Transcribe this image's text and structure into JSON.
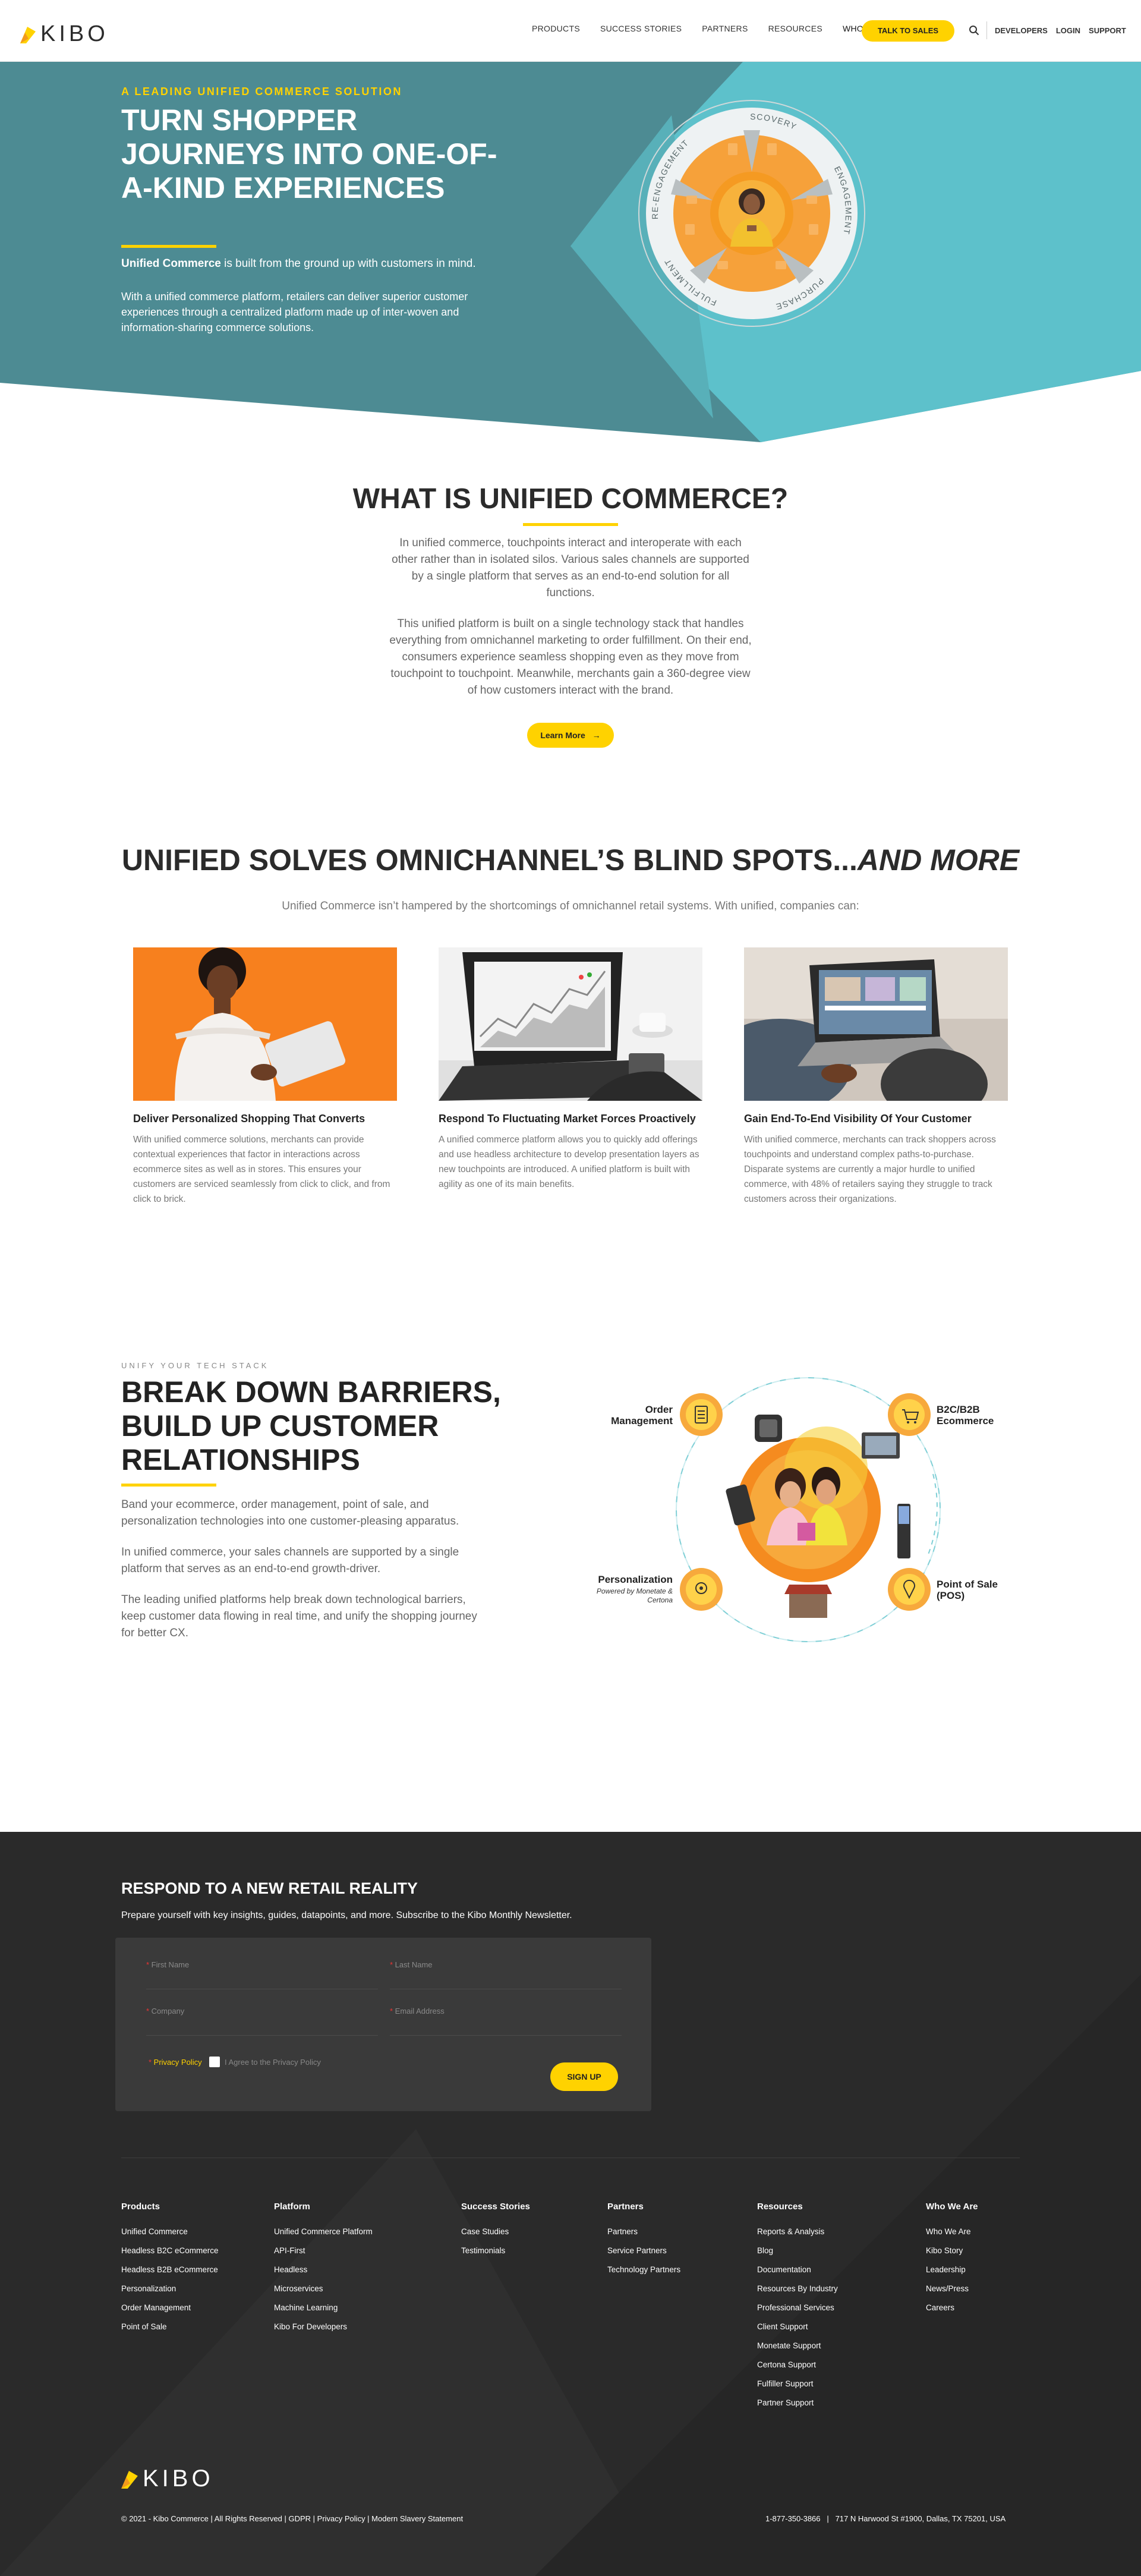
{
  "header": {
    "brand": "KIBO",
    "nav": [
      "PRODUCTS",
      "SUCCESS STORIES",
      "PARTNERS",
      "RESOURCES",
      "WHO WE ARE"
    ],
    "cta": "TALK TO SALES",
    "utility": [
      "DEVELOPERS",
      "LOGIN",
      "SUPPORT"
    ]
  },
  "hero": {
    "eyebrow": "A LEADING UNIFIED COMMERCE SOLUTION",
    "title": "TURN SHOPPER JOURNEYS INTO ONE-OF-A-KIND EXPERIENCES",
    "p1_bold": "Unified Commerce",
    "p1_rest": " is built from the ground up with customers in mind.",
    "p2": "With a unified commerce platform, retailers can deliver superior customer experiences through a centralized platform made up of inter-woven and information-sharing commerce solutions.",
    "wheel": [
      "DISCOVERY",
      "ENGAGEMENT",
      "PURCHASE",
      "FULFILLMENT",
      "RE-ENGAGEMENT"
    ]
  },
  "what": {
    "title": "WHAT IS UNIFIED COMMERCE?",
    "p1": "In unified commerce, touchpoints interact and interoperate with each other rather than in isolated silos. Various sales channels are supported by a single platform that serves as an end-to-end solution for all functions.",
    "p2": "This unified platform is built on a single technology stack that handles everything from omnichannel marketing to order fulfillment. On their end, consumers experience seamless shopping even as they move from touchpoint to touchpoint. Meanwhile, merchants gain a 360-degree view of how customers interact with the brand.",
    "button": "Learn More"
  },
  "blind": {
    "title_main": "UNIFIED SOLVES OMNICHANNEL’S BLIND SPOTS...",
    "title_italic": "AND MORE",
    "subtitle": "Unified Commerce isn’t hampered by the shortcomings of omnichannel retail systems. With unified, companies can:",
    "cards": [
      {
        "title": "Deliver Personalized Shopping That Converts",
        "text": "With unified commerce solutions, merchants can provide contextual experiences that factor in interactions across ecommerce sites as well as in stores. This ensures your customers are serviced seamlessly from click to click, and from click to brick."
      },
      {
        "title": "Respond To Fluctuating Market Forces Proactively",
        "text": "A unified commerce platform allows you to quickly add offerings and use headless architecture to develop presentation layers as new touchpoints are introduced. A unified platform is built with agility as one of its main benefits."
      },
      {
        "title": "Gain End-To-End Visibility Of Your Customer",
        "text": "With unified commerce, merchants can track shoppers across touchpoints and understand complex paths-to-purchase. Disparate systems are currently a major hurdle to unified commerce, with 48% of retailers saying they struggle to track customers across their organizations."
      }
    ]
  },
  "barriers": {
    "eyebrow": "UNIFY YOUR TECH STACK",
    "title": "BREAK DOWN BARRIERS, BUILD UP CUSTOMER RELATIONSHIPS",
    "p1": "Band your ecommerce, order management, point of sale, and personalization technologies into one customer-pleasing apparatus.",
    "p2": "In unified commerce, your sales channels are supported by a single platform that serves as an end-to-end growth-driver.",
    "p3": "The leading unified platforms help break down technological barriers, keep customer data flowing in real time, and unify the shopping journey for better CX.",
    "nodes": {
      "order": "Order Management",
      "b2c": "B2C/B2B Ecommerce",
      "pers": "Personalization",
      "pers_sub": "Powered by Monetate & Certona",
      "pos": "Point of Sale (POS)"
    }
  },
  "newsletter": {
    "title": "RESPOND TO A NEW RETAIL REALITY",
    "subtitle": "Prepare yourself with key insights, guides, datapoints, and more. Subscribe to the Kibo Monthly Newsletter.",
    "first": "First Name",
    "last": "Last Name",
    "company": "Company",
    "email": "Email Address",
    "privacy": "Privacy Policy",
    "agree": "I Agree to the Privacy Policy",
    "button": "SIGN UP"
  },
  "footer": {
    "columns": [
      {
        "title": "Products",
        "items": [
          "Unified Commerce",
          "Headless B2C eCommerce",
          "Headless B2B eCommerce",
          "Personalization",
          "Order Management",
          "Point of Sale"
        ]
      },
      {
        "title": "Platform",
        "items": [
          "Unified Commerce Platform",
          "API-First",
          "Headless",
          "Microservices",
          "Machine Learning",
          "Kibo For Developers"
        ]
      },
      {
        "title": "Success Stories",
        "items": [
          "Case Studies",
          "Testimonials"
        ]
      },
      {
        "title": "Partners",
        "items": [
          "Partners",
          "Service Partners",
          "Technology Partners"
        ]
      },
      {
        "title": "Resources",
        "items": [
          "Reports & Analysis",
          "Blog",
          "Documentation",
          "Resources By Industry",
          "Professional Services",
          "Client Support",
          "Monetate Support",
          "Certona Support",
          "Fulfiller Support",
          "Partner Support"
        ]
      },
      {
        "title": "Who We Are",
        "items": [
          "Who We Are",
          "Kibo Story",
          "Leadership",
          "News/Press",
          "Careers"
        ]
      }
    ],
    "brand": "KIBO",
    "copyright": "© 2021 - Kibo Commerce | All Rights Reserved | GDPR | Privacy Policy | Modern Slavery Statement",
    "address": "1-877-350-3866   |   717 N Harwood St #1900, Dallas, TX 75201, USA"
  },
  "colors": {
    "accent": "#ffd200",
    "teal": "#4d8c94",
    "light_teal": "#5ec4ce",
    "orange": "#f7921e",
    "dark": "#2a2a2a"
  }
}
